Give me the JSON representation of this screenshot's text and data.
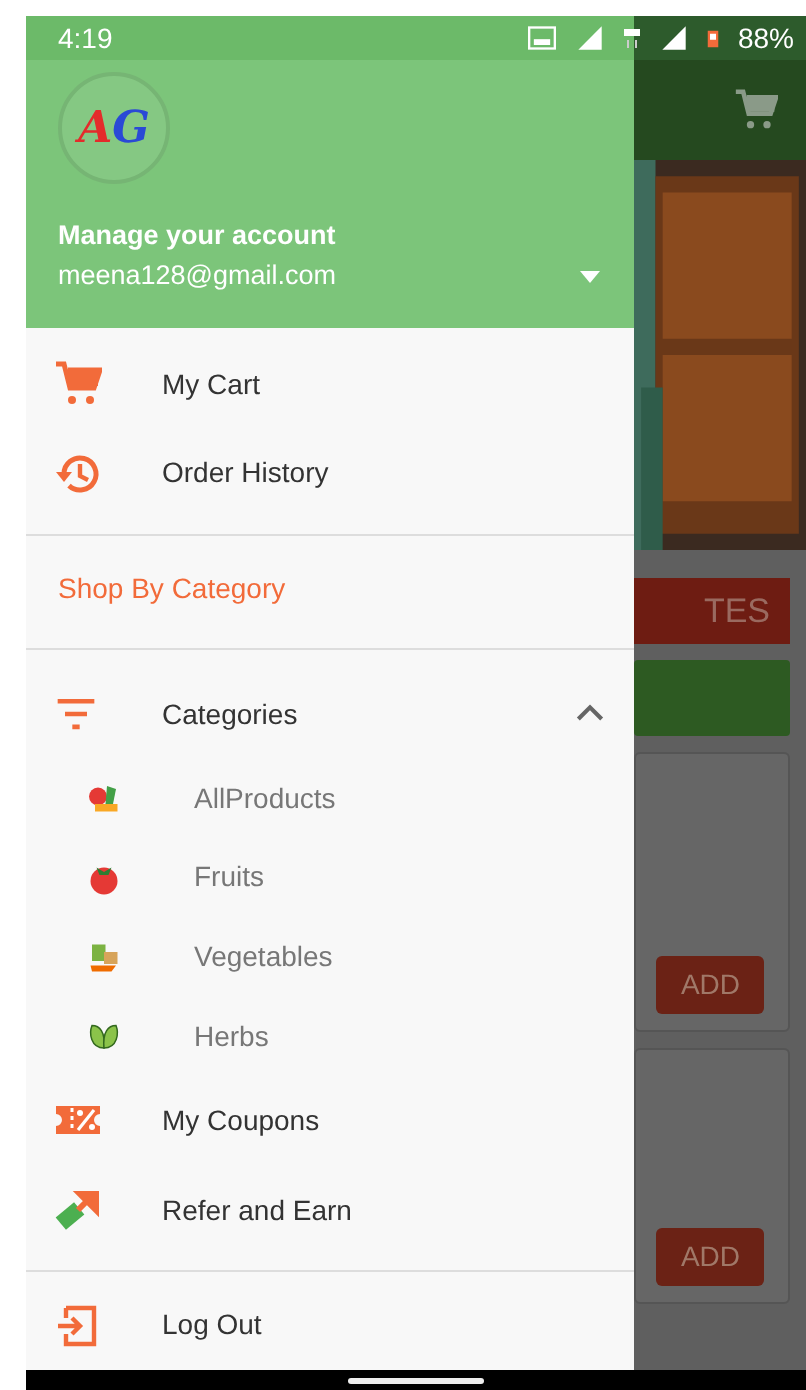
{
  "status_bar": {
    "time": "4:19",
    "battery": "88%"
  },
  "drawer": {
    "header": {
      "logo_text": "AG",
      "title": "Manage your account",
      "email": "meena128@gmail.com",
      "expanded": false
    },
    "items": [
      {
        "kind": "item",
        "label": "My Cart"
      },
      {
        "kind": "item",
        "label": "Order History"
      },
      {
        "kind": "divider"
      },
      {
        "kind": "section",
        "label": "Shop By Category"
      },
      {
        "kind": "divider"
      },
      {
        "kind": "group",
        "label": "Categories",
        "expanded": true,
        "children": [
          {
            "label": "AllProducts"
          },
          {
            "label": "Fruits"
          },
          {
            "label": "Vegetables"
          },
          {
            "label": "Herbs"
          }
        ]
      },
      {
        "kind": "item",
        "label": "My Coupons"
      },
      {
        "kind": "item",
        "label": "Refer and Earn"
      },
      {
        "kind": "divider"
      },
      {
        "kind": "item",
        "label": "Log Out"
      }
    ]
  },
  "background": {
    "banner_button": "TES",
    "add_buttons": [
      "ADD",
      "ADD"
    ]
  }
}
